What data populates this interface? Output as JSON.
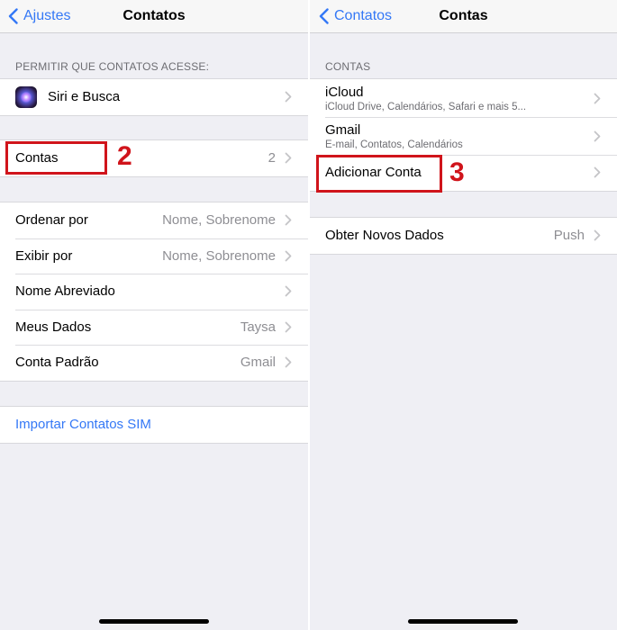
{
  "left": {
    "back_label": "Ajustes",
    "title": "Contatos",
    "section_header": "PERMITIR QUE CONTATOS ACESSE:",
    "siri_row": {
      "label": "Siri e Busca"
    },
    "contas_row": {
      "label": "Contas",
      "value": "2"
    },
    "settings_rows": [
      {
        "label": "Ordenar por",
        "value": "Nome, Sobrenome"
      },
      {
        "label": "Exibir por",
        "value": "Nome, Sobrenome"
      },
      {
        "label": "Nome Abreviado",
        "value": ""
      },
      {
        "label": "Meus Dados",
        "value": "Taysa"
      },
      {
        "label": "Conta Padrão",
        "value": "Gmail"
      }
    ],
    "import_label": "Importar Contatos SIM",
    "step_label": "2"
  },
  "right": {
    "back_label": "Contatos",
    "title": "Contas",
    "section_header": "CONTAS",
    "accounts": [
      {
        "label": "iCloud",
        "sub": "iCloud Drive, Calendários, Safari e mais 5..."
      },
      {
        "label": "Gmail",
        "sub": "E-mail, Contatos, Calendários"
      }
    ],
    "add_account_label": "Adicionar Conta",
    "fetch_row": {
      "label": "Obter Novos Dados",
      "value": "Push"
    },
    "step_label": "3"
  },
  "colors": {
    "accent": "#3478f6",
    "annotation": "#d0141b",
    "background": "#efeff4"
  }
}
